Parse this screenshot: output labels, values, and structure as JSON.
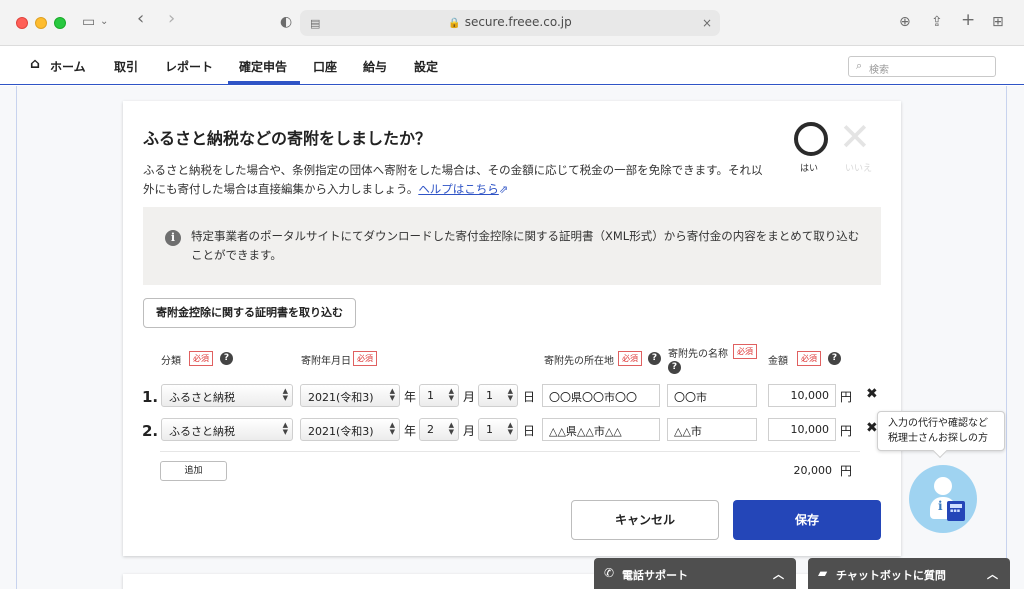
{
  "browser": {
    "url": "secure.freee.co.jp"
  },
  "nav": {
    "items": [
      {
        "label": "ホーム"
      },
      {
        "label": "取引"
      },
      {
        "label": "レポート"
      },
      {
        "label": "確定申告"
      },
      {
        "label": "口座"
      },
      {
        "label": "給与"
      },
      {
        "label": "設定"
      }
    ],
    "active": "確定申告",
    "search_placeholder": "検索"
  },
  "question": {
    "title": "ふるさと納税などの寄附をしましたか？",
    "description": "ふるさと納税をした場合や、条例指定の団体へ寄附をした場合は、その金額に応じて税金の一部を免除できます。それ以外にも寄付した場合は直接編集から入力しましょう。",
    "help_link": "ヘルプはこちら",
    "yes_label": "はい",
    "no_label": "いいえ",
    "selected": "はい"
  },
  "info": {
    "text": "特定事業者のポータルサイトにてダウンロードした寄付金控除に関する証明書（XML形式）から寄付金の内容をまとめて取り込むことができます。"
  },
  "import_button": "寄附金控除に関する証明書を取り込む",
  "table": {
    "required_label": "必須",
    "headers": {
      "category": "分類",
      "date": "寄附年月日",
      "location": "寄附先の所在地",
      "name": "寄附先の名称",
      "amount": "金額"
    },
    "units": {
      "year": "年",
      "month": "月",
      "day": "日",
      "yen": "円"
    },
    "rows": [
      {
        "num": "1.",
        "category": "ふるさと納税",
        "year": "2021(令和3)",
        "month": "1",
        "day": "1",
        "location": "〇〇県〇〇市〇〇",
        "name": "〇〇市",
        "amount": "10,000"
      },
      {
        "num": "2.",
        "category": "ふるさと納税",
        "year": "2021(令和3)",
        "month": "2",
        "day": "1",
        "location": "△△県△△市△△",
        "name": "△△市",
        "amount": "10,000"
      }
    ],
    "add_button": "追加",
    "total": "20,000"
  },
  "actions": {
    "cancel": "キャンセル",
    "save": "保存"
  },
  "assistant": {
    "line1": "入力の代行や確認など",
    "line2": "税理士さんお探しの方"
  },
  "bottom": {
    "phone_support": "電話サポート",
    "chatbot": "チャットボットに質問"
  },
  "colors": {
    "accent": "#2446b8",
    "required": "#dd3333"
  }
}
